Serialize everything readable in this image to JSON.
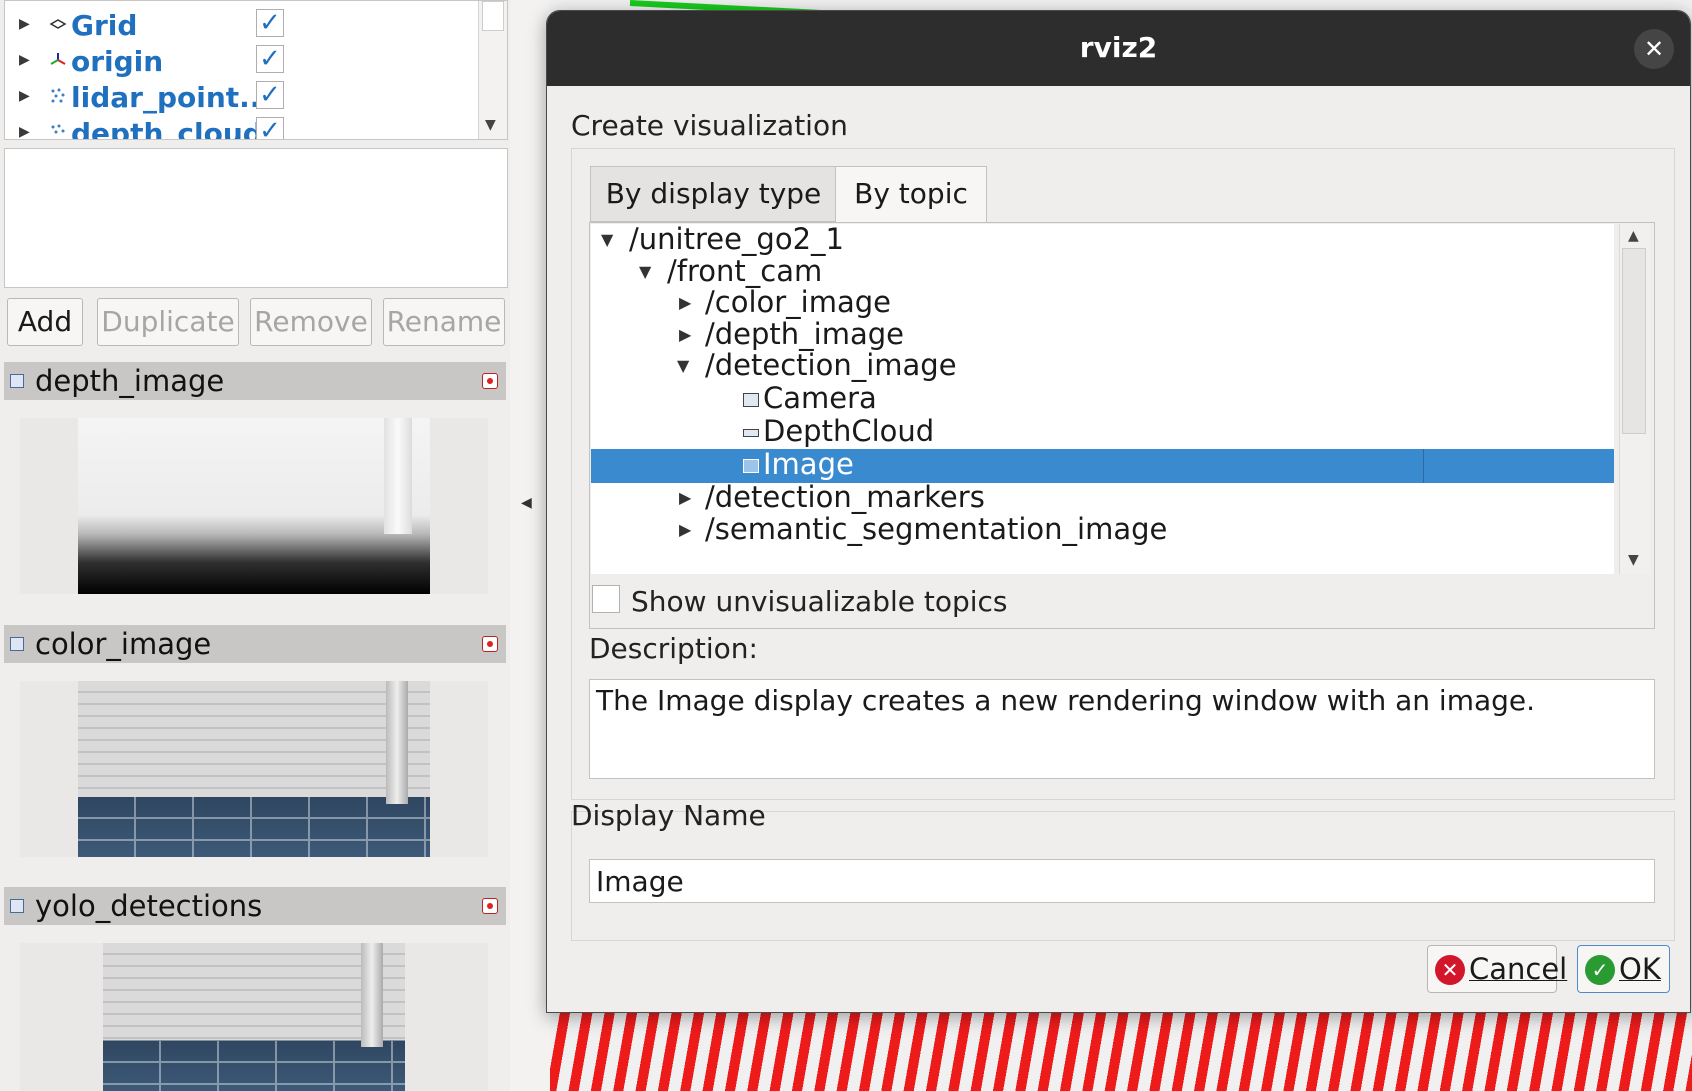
{
  "displays": {
    "items": [
      {
        "label": "Grid",
        "icon": "grid-icon",
        "checked": true
      },
      {
        "label": "origin",
        "icon": "axes-icon",
        "checked": true
      },
      {
        "label": "lidar_point...",
        "icon": "point-cloud-icon",
        "checked": true
      },
      {
        "label": "depth_cloud",
        "icon": "point-cloud-icon",
        "checked": true
      }
    ],
    "check_glyph": "✓",
    "buttons": {
      "add": "Add",
      "duplicate": "Duplicate",
      "remove": "Remove",
      "rename": "Rename"
    }
  },
  "image_panels": [
    {
      "title": "depth_image"
    },
    {
      "title": "color_image"
    },
    {
      "title": "yolo_detections"
    }
  ],
  "dialog": {
    "title": "rviz2",
    "close_glyph": "✕",
    "section_title": "Create visualization",
    "tabs": {
      "by_display_type": "By display type",
      "by_topic": "By topic",
      "active": "By topic"
    },
    "topic_tree": [
      {
        "label": "/unitree_go2_1",
        "expanded": true
      },
      {
        "label": "/front_cam",
        "expanded": true
      },
      {
        "label": "/color_image",
        "expanded": false
      },
      {
        "label": "/depth_image",
        "expanded": false
      },
      {
        "label": "/detection_image",
        "expanded": true
      },
      {
        "label": "Camera",
        "icon": "camera-icon"
      },
      {
        "label": "DepthCloud",
        "icon": "depth-cloud-icon"
      },
      {
        "label": "Image",
        "icon": "image-icon",
        "selected": true
      },
      {
        "label": "/detection_markers",
        "expanded": false
      },
      {
        "label": "/semantic_segmentation_image",
        "expanded": false
      }
    ],
    "show_unvisualizable_label": "Show unvisualizable topics",
    "show_unvisualizable_checked": false,
    "description_label": "Description:",
    "description_text": "The Image display creates a new rendering window with an image.",
    "display_name_label": "Display Name",
    "display_name_value": "Image",
    "cancel_label": "Cancel",
    "ok_label": "OK"
  },
  "colors": {
    "selection": "#3a8ad0",
    "display_label": "#2070c0",
    "titlebar": "#2d2d2d",
    "cancel_icon": "#d2172d",
    "ok_icon": "#2a9a32"
  }
}
